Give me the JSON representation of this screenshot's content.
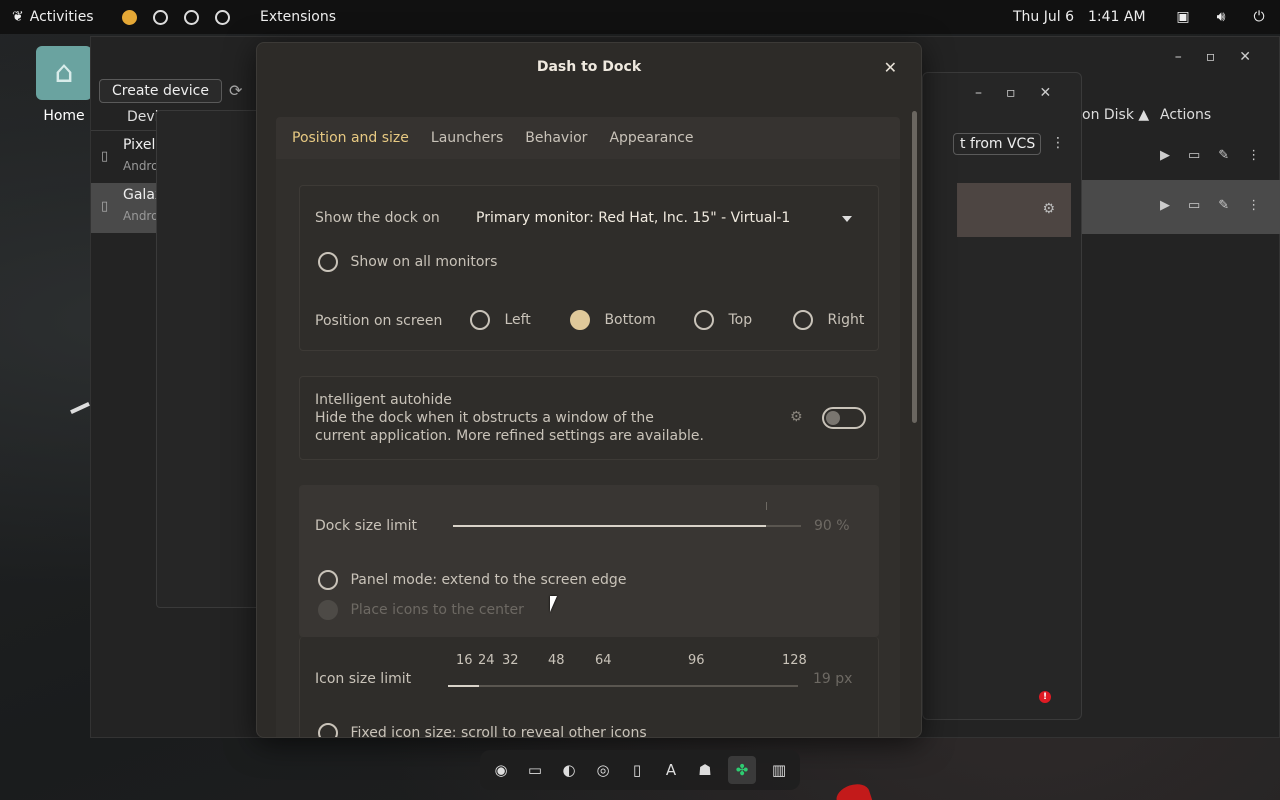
{
  "topbar": {
    "activities": "Activities",
    "app_name": "Extensions",
    "date": "Thu Jul 6",
    "time": "1:41 AM"
  },
  "desktop": {
    "home_label": "Home"
  },
  "bg_window": {
    "create_button": "Create device",
    "devices_header": "Devi",
    "devices": [
      {
        "name": "Pixel",
        "sub": "Andro"
      },
      {
        "name": "Galax",
        "sub": "Andro"
      }
    ],
    "col_on_disk": "on Disk ▲",
    "col_actions": "Actions"
  },
  "right_window": {
    "vcs_button": "t from VCS"
  },
  "dialog": {
    "title": "Dash to Dock",
    "tabs": [
      "Position and size",
      "Launchers",
      "Behavior",
      "Appearance"
    ],
    "show_dock_on_label": "Show the dock on",
    "monitor_value": "Primary monitor: Red Hat, Inc. 15\" - Virtual-1",
    "show_all_monitors": "Show on all monitors",
    "position_label": "Position on screen",
    "positions": [
      "Left",
      "Bottom",
      "Top",
      "Right"
    ],
    "selected_position": "Bottom",
    "autohide_title": "Intelligent autohide",
    "autohide_desc1": "Hide the dock when it obstructs a window of the",
    "autohide_desc2": "current application. More refined settings are available.",
    "dock_size_label": "Dock size limit",
    "dock_size_value": "90 %",
    "dock_size_fraction": 0.9,
    "panel_mode": "Panel mode: extend to the screen edge",
    "center_icons": "Place icons to the center",
    "icon_size_label": "Icon size limit",
    "icon_size_marks": [
      "16",
      "24",
      "32",
      "48",
      "64",
      "96",
      "128"
    ],
    "icon_size_value": "19 px",
    "fixed_icon": "Fixed icon size: scroll to reveal other icons"
  },
  "dock_icons": [
    "eye-icon",
    "files-icon",
    "firefox-icon",
    "chrome-icon",
    "terminal-icon",
    "font-icon",
    "android-icon",
    "extension-icon",
    "trash-icon"
  ],
  "colors": {
    "accent": "#e7c982",
    "workspace_active": "#e5a836"
  }
}
